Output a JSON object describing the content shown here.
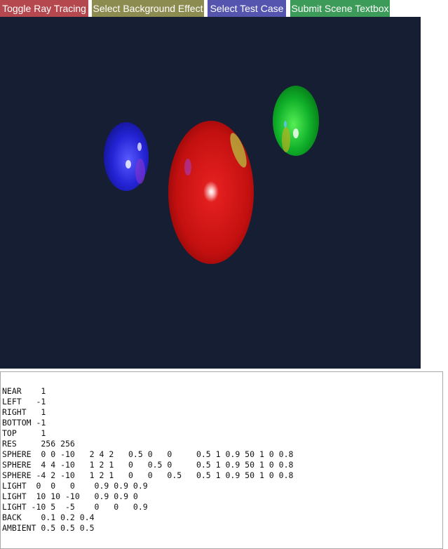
{
  "toolbar": {
    "buttons": [
      {
        "label": "Toggle Ray Tracing",
        "color": "#b5484e"
      },
      {
        "label": "Select Background Effect",
        "color": "#8c8b50"
      },
      {
        "label": "Select Test Case",
        "color": "#5555b0"
      },
      {
        "label": "Submit Scene Textbox",
        "color": "#3d9b5a"
      }
    ]
  },
  "viewport": {
    "background_color": "#161e33",
    "spheres": [
      {
        "name": "red-sphere",
        "color": "#cc1111"
      },
      {
        "name": "green-sphere",
        "color": "#11aa22"
      },
      {
        "name": "blue-sphere",
        "color": "#2222cc"
      }
    ]
  },
  "scene_textbox": {
    "value": "NEAR    1\nLEFT   -1\nRIGHT   1\nBOTTOM -1\nTOP     1\nRES     256 256\nSPHERE  0 0 -10   2 4 2   0.5 0   0     0.5 1 0.9 50 1 0 0.8\nSPHERE  4 4 -10   1 2 1   0   0.5 0     0.5 1 0.9 50 1 0 0.8\nSPHERE -4 2 -10   1 2 1   0   0   0.5   0.5 1 0.9 50 1 0 0.8\nLIGHT  0  0   0    0.9 0.9 0.9\nLIGHT  10 10 -10   0.9 0.9 0\nLIGHT -10 5  -5    0   0   0.9\nBACK    0.1 0.2 0.4\nAMBIENT 0.5 0.5 0.5"
  }
}
